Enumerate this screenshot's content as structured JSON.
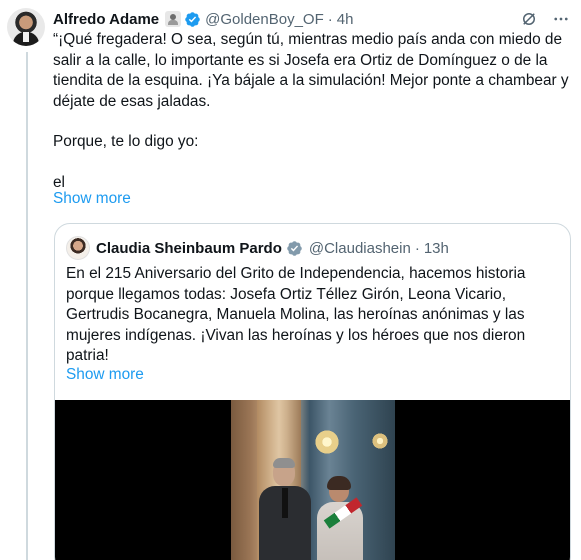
{
  "tweet": {
    "author_name": "Alfredo Adame",
    "handle": "@GoldenBoy_OF",
    "separator": "·",
    "time": "4h",
    "paragraphs": [
      "“¡Qué fregadera! O sea, según tú, mientras medio país anda con miedo de salir a la calle, lo importante es si Josefa era Ortiz de Domínguez o de la tiendita de la esquina. ¡Ya bájale a la simulación! Mejor ponte a chambear y déjate de esas jaladas.",
      "Porque, te lo digo yo:",
      "el"
    ],
    "show_more": "Show more"
  },
  "quote": {
    "author_name": "Claudia Sheinbaum Pardo",
    "handle": "@Claudiashein",
    "separator": "·",
    "time": "13h",
    "text": "En el 215 Aniversario del Grito de Independencia, hacemos historia porque llegamos todas: Josefa Ortiz Téllez Girón, Leona Vicario, Gertrudis Bocanegra, Manuela Molina, las heroínas anónimas y las mujeres indígenas. ¡Vivan las heroínas y los héroes que nos dieron patria!",
    "show_more": "Show more"
  },
  "icons": {
    "verified": "verified-badge-icon",
    "grok": "grok-icon",
    "more": "more-options-icon",
    "emoji": "emoji-badge-icon"
  },
  "colors": {
    "link": "#1d9bf0",
    "secondary_text": "#536471",
    "border": "#cfd9de"
  }
}
